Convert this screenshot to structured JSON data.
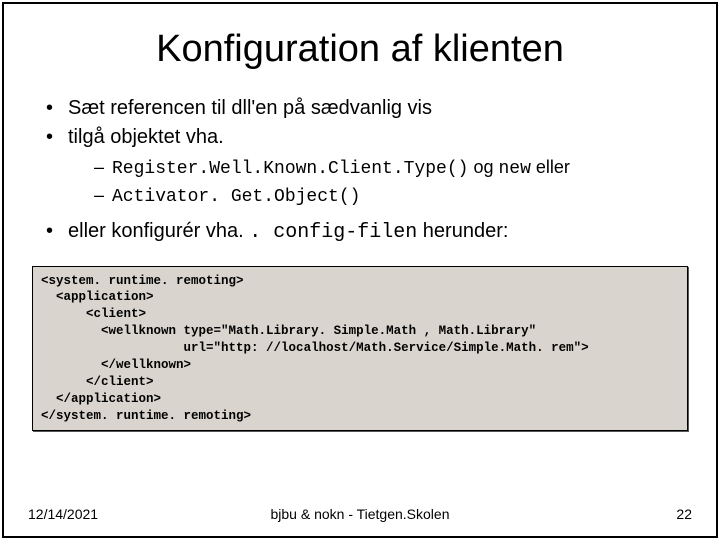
{
  "title": "Konfiguration af klienten",
  "bullets": {
    "b1": "Sæt referencen til dll'en på sædvanlig vis",
    "b2": "tilgå objektet vha.",
    "sub1_code": "Register.Well.Known.Client.Type()",
    "sub1_mid": " og ",
    "sub1_new": "new",
    "sub1_tail": " eller",
    "sub2_code": "Activator. Get.Object()",
    "b3_pre": "eller konfigurér vha. ",
    "b3_code": ". config-filen",
    "b3_post": " herunder:"
  },
  "code": {
    "l1a": "<system. runtime. remoting>",
    "l2a": "  <application>",
    "l3a": "      <client>",
    "l4a": "        <wellknown ",
    "l4t": "type",
    "l4b": "=\"Math.Library. Simple.Math , Math.Library\"",
    "l5a": "                   ",
    "l5u": "url",
    "l5b": "=\"http: //localhost/Math.Service/Simple.Math. rem\">",
    "l6a": "        </wellknown>",
    "l7a": "      </client>",
    "l8a": "  </application>",
    "l9a": "</system. runtime. remoting>"
  },
  "footer": {
    "date": "12/14/2021",
    "center": "bjbu & nokn - Tietgen.Skolen",
    "page": "22"
  }
}
